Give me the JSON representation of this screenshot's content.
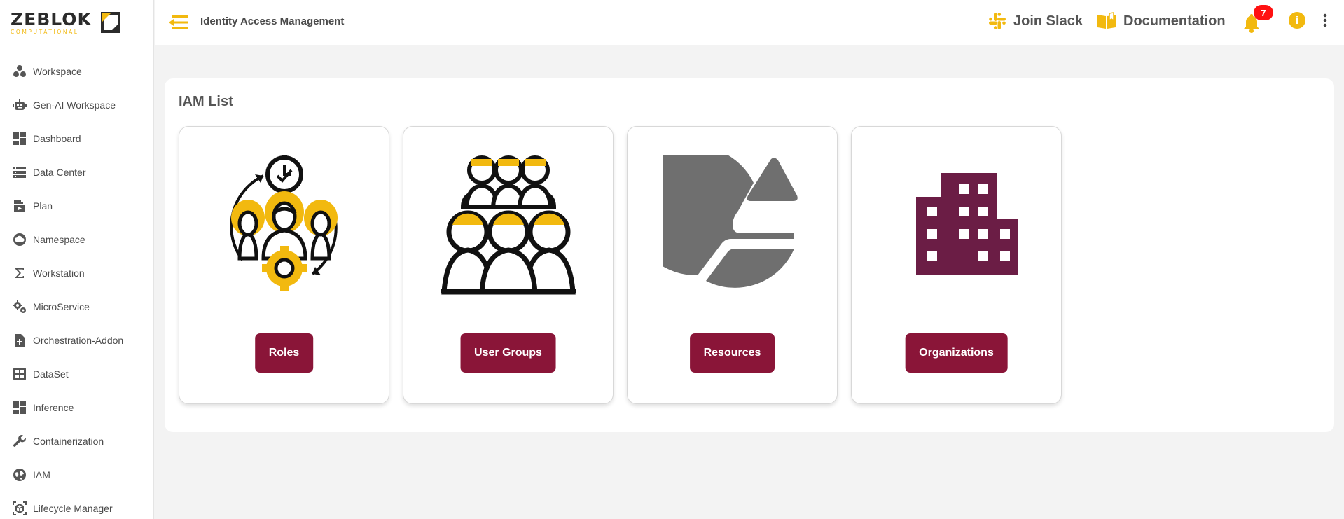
{
  "brand": {
    "name": "ZEBLOK",
    "tagline": "COMPUTATIONAL",
    "accent": "#f2b90f",
    "primary": "#8a1538"
  },
  "sidebar": {
    "items": [
      {
        "label": "Workspace",
        "icon": "workspace-icon"
      },
      {
        "label": "Gen-AI Workspace",
        "icon": "robot-icon"
      },
      {
        "label": "Dashboard",
        "icon": "dashboard-icon"
      },
      {
        "label": "Data Center",
        "icon": "storage-icon"
      },
      {
        "label": "Plan",
        "icon": "plan-icon"
      },
      {
        "label": "Namespace",
        "icon": "cloud-icon"
      },
      {
        "label": "Workstation",
        "icon": "sigma-icon"
      },
      {
        "label": "MicroService",
        "icon": "gears-icon"
      },
      {
        "label": "Orchestration-Addon",
        "icon": "file-add-icon"
      },
      {
        "label": "DataSet",
        "icon": "grid-icon"
      },
      {
        "label": "Inference",
        "icon": "dashboard-icon"
      },
      {
        "label": "Containerization",
        "icon": "wrench-icon"
      },
      {
        "label": "IAM",
        "icon": "globe-icon"
      },
      {
        "label": "Lifecycle Manager",
        "icon": "lifecycle-icon"
      }
    ]
  },
  "header": {
    "title": "Identity Access Management",
    "slack_label": "Join Slack",
    "docs_label": "Documentation",
    "notification_count": "7",
    "info_symbol": "i"
  },
  "main": {
    "title": "IAM List",
    "cards": [
      {
        "label": "Roles",
        "icon": "roles-icon"
      },
      {
        "label": "User Groups",
        "icon": "user-groups-icon"
      },
      {
        "label": "Resources",
        "icon": "resources-icon"
      },
      {
        "label": "Organizations",
        "icon": "organization-building-icon"
      }
    ]
  }
}
